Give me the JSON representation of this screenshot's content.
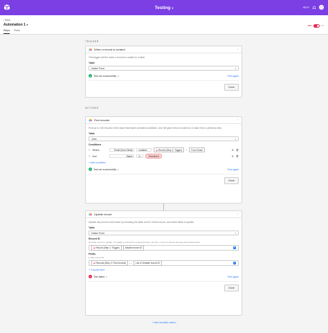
{
  "topbar": {
    "title": "Testing",
    "help": "HELP"
  },
  "subheader": {
    "back": "‹ Back",
    "automation_name": "Automation 1",
    "tabs": [
      {
        "label": "Steps"
      },
      {
        "label": "Runs"
      }
    ],
    "toggle_off": "OFF",
    "toggle_on": "ON"
  },
  "trigger": {
    "section": "TRIGGER",
    "title": "When a record is created",
    "description": "This trigger will fire when a record is created in a table.",
    "table_label": "Table",
    "table_value": "Intake Form",
    "status": "Test ran successfully",
    "test_again": "Test again",
    "done": "Done"
  },
  "actions": {
    "section": "ACTIONS",
    "find": {
      "title": "Find records",
      "description": "Find up to 100 records in this base that match provided conditions. Use the gear menu to match on a value from a previous step.",
      "table_label": "Table",
      "table_value": "Jobs",
      "conditions_label": "Conditions",
      "rows": [
        {
          "prefix": "Where",
          "field": "Email (from Client)",
          "op": "contains",
          "token": "Record (Step 1: Trigger)",
          "sep": "›",
          "value": "Form Email"
        },
        {
          "prefix": "And",
          "field": "Status",
          "op": "is",
          "value": "Scheduled"
        }
      ],
      "add_condition": "Add condition",
      "status": "Test ran successfully",
      "test_again": "Test again",
      "done": "Done"
    },
    "update": {
      "title": "Update record",
      "description": "Update any record in this base by choosing the table and ID of that record, and which fields to update.",
      "table_label": "Table",
      "table_value": "Intake Form",
      "record_id_label": "Record ID",
      "record_id_sub": "ID of the record to update. To update a record from a previous step, use the + menu to choose the step and its Record ID.",
      "token1": "Record (Step 1: Trigger)",
      "token2": "Airtable record ID",
      "fields_label": "Fields",
      "field_name": "Jobs record ID",
      "field_token1": "Records (Step 2: Find records)",
      "field_token2": "List of 'Airtable record ID'",
      "choose_field": "Choose field",
      "status": "Test failed",
      "test_again": "Test again",
      "done": "Done"
    },
    "add_another": "+ Add another action"
  },
  "colors": {
    "brand": "#7b3fe4",
    "link": "#2d7ff9",
    "success": "#20b26b",
    "error": "#e8254f"
  }
}
